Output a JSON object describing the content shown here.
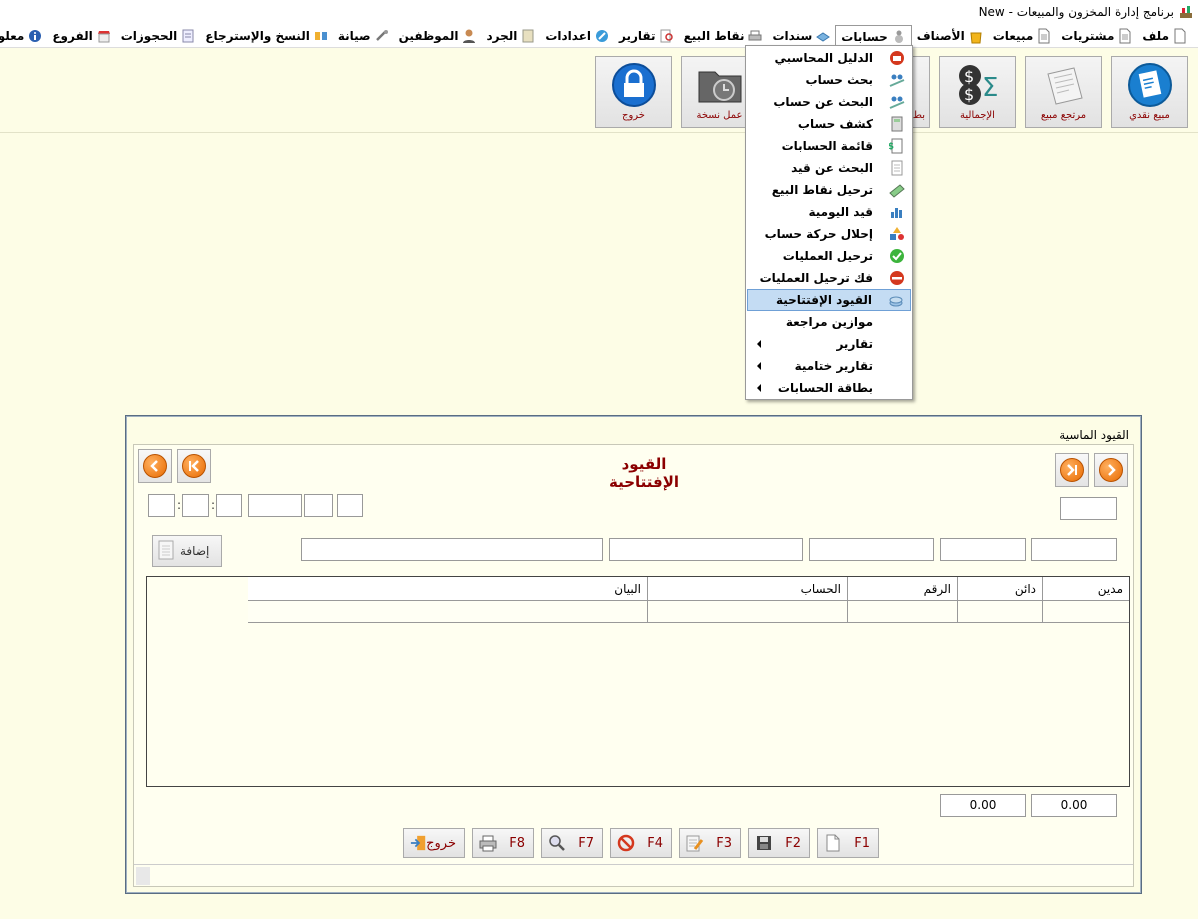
{
  "titlebar": {
    "title": "برنامج إدارة المخزون والمبيعات  - New"
  },
  "menubar": {
    "items": [
      {
        "label": "ملف",
        "icon": "file-icon"
      },
      {
        "label": "مشتريات",
        "icon": "document-icon"
      },
      {
        "label": "مبيعات",
        "icon": "document-icon"
      },
      {
        "label": "الأصناف",
        "icon": "bag-icon"
      },
      {
        "label": "حسابات",
        "icon": "accounts-icon"
      },
      {
        "label": "سندات",
        "icon": "receipt-icon"
      },
      {
        "label": "نقاط البيع",
        "icon": "printer-icon"
      },
      {
        "label": "تقارير",
        "icon": "report-search-icon"
      },
      {
        "label": "اعدادات",
        "icon": "settings-icon"
      },
      {
        "label": "الجرد",
        "icon": "ledger-icon"
      },
      {
        "label": "الموظفين",
        "icon": "employee-icon"
      },
      {
        "label": "صيانة",
        "icon": "tools-icon"
      },
      {
        "label": "النسخ والإسترجاع",
        "icon": "backup-icon"
      },
      {
        "label": "الحجوزات",
        "icon": "booking-icon"
      },
      {
        "label": "الفروع",
        "icon": "store-icon"
      },
      {
        "label": "معلومات",
        "icon": "info-icon"
      }
    ]
  },
  "toolbar": {
    "buttons": [
      {
        "label": "مبيع نقدي",
        "icon": "invoice-icon"
      },
      {
        "label": "مرتجع مبيع",
        "icon": "receipt-return-icon"
      },
      {
        "label": "الإجمالية",
        "icon": "dollar-sigma-icon"
      },
      {
        "label": "بط",
        "icon": "partial-icon"
      },
      {
        "label": "عمل نسخة",
        "icon": "backup-folder-icon"
      },
      {
        "label": "خروج",
        "icon": "lock-icon"
      }
    ]
  },
  "accounts_menu": {
    "items": [
      {
        "label": "الدليل المحاسبي",
        "icon": "bank-icon"
      },
      {
        "label": "بحث حساب",
        "icon": "people-search-icon"
      },
      {
        "label": "البحث عن حساب",
        "icon": "people-search-icon"
      },
      {
        "label": "كشف حساب",
        "icon": "calculator-icon"
      },
      {
        "label": "قائمة الحسابات",
        "icon": "dollar-doc-icon"
      },
      {
        "label": "البحث عن قيد",
        "icon": "doc-icon"
      },
      {
        "label": "ترحيل نقاط البيع",
        "icon": "money-icon"
      },
      {
        "label": "قيد اليومية",
        "icon": "chart-icon"
      },
      {
        "label": "إحلال حركة حساب",
        "icon": "shapes-icon"
      },
      {
        "label": "ترحيل العمليات",
        "icon": "check-icon"
      },
      {
        "label": "فك ترحيل العمليات",
        "icon": "minus-icon"
      },
      {
        "label": "القيود الإفتتاحية",
        "icon": "coins-icon"
      },
      {
        "label": "موازين مراجعة",
        "icon": ""
      },
      {
        "label": "تقارير",
        "icon": ""
      },
      {
        "label": "تقارير ختامية",
        "icon": ""
      },
      {
        "label": "بطاقة الحسابات",
        "icon": ""
      }
    ]
  },
  "window": {
    "title": "القيود الماسية",
    "form_title": "القيود الإفتتاحية",
    "add_button": "إضافة",
    "grid": {
      "columns": [
        "مدين",
        "دائن",
        "الرقم",
        "الحساب",
        "البيان"
      ]
    },
    "totals": {
      "debit": "0.00",
      "credit": "0.00"
    },
    "fkeys": [
      "F1",
      "F2",
      "F3",
      "F4",
      "F7",
      "F8"
    ],
    "exit_label": "خروج"
  }
}
